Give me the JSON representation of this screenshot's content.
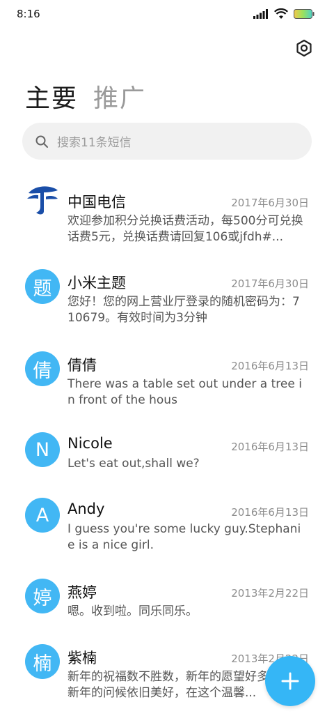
{
  "status_bar": {
    "time": "8:16",
    "icons": [
      "signal-icon",
      "wifi-icon",
      "battery-icon"
    ]
  },
  "header": {
    "settings_icon": "settings-icon",
    "tabs": [
      {
        "label": "主要",
        "active": true
      },
      {
        "label": "推广",
        "active": false
      }
    ]
  },
  "search": {
    "placeholder": "搜索11条短信",
    "icon": "search-icon"
  },
  "colors": {
    "accent": "#42b7f4",
    "fab": "#35b6f6"
  },
  "messages": [
    {
      "avatar": "",
      "avatar_type": "china-telecom-logo",
      "name": "中国电信",
      "date": "2017年6月30日",
      "preview": "欢迎参加积分兑换话费活动，每500分可兑换话费5元，兑换话费请回复106或jfdh#..."
    },
    {
      "avatar": "题",
      "name": "小米主题",
      "date": "2017年6月30日",
      "preview": "您好！您的网上营业厅登录的随机密码为：710679。有效时间为3分钟"
    },
    {
      "avatar": "倩",
      "name": "倩倩",
      "date": "2016年6月13日",
      "preview": "There was a table set out under a tree in front of the hous"
    },
    {
      "avatar": "N",
      "name": "Nicole",
      "date": "2016年6月13日",
      "preview": "Let's eat out,shall we?"
    },
    {
      "avatar": "A",
      "name": "Andy",
      "date": "2016年6月13日",
      "preview": "I guess you're some lucky guy.Stephanie is a nice girl."
    },
    {
      "avatar": "婷",
      "name": "燕婷",
      "date": "2013年2月22日",
      "preview": "嗯。收到啦。同乐同乐。"
    },
    {
      "avatar": "楠",
      "name": "紫楠",
      "date": "2013年2月22日",
      "preview": "新年的祝福数不胜数，新年的愿望好多好多，新年的问候依旧美好，在这个温馨..."
    }
  ],
  "fab": {
    "icon": "plus-icon"
  }
}
